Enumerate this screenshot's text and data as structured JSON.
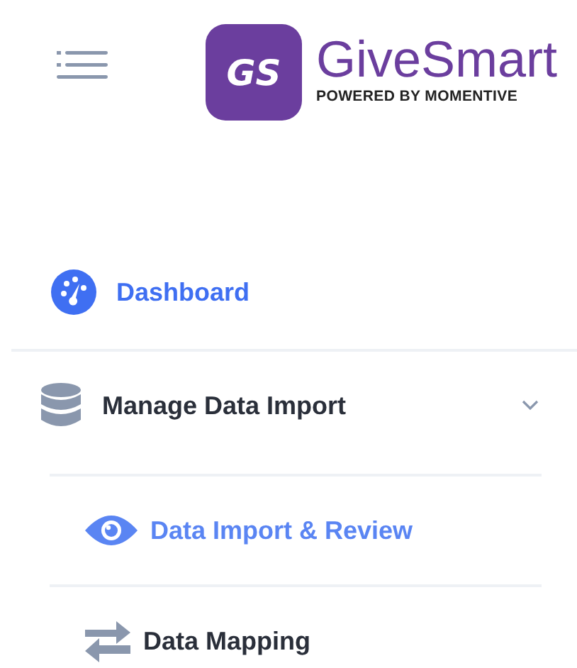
{
  "brand": {
    "monogram": "GS",
    "name": "GiveSmart",
    "tagline": "POWERED BY MOMENTIVE"
  },
  "nav": {
    "items": [
      {
        "label": "Dashboard",
        "selected": true
      },
      {
        "label": "Manage Data Import",
        "selected": false,
        "expanded": true,
        "children": [
          {
            "label": "Data Import & Review",
            "selected": true
          },
          {
            "label": "Data Mapping",
            "selected": false
          }
        ]
      }
    ]
  }
}
